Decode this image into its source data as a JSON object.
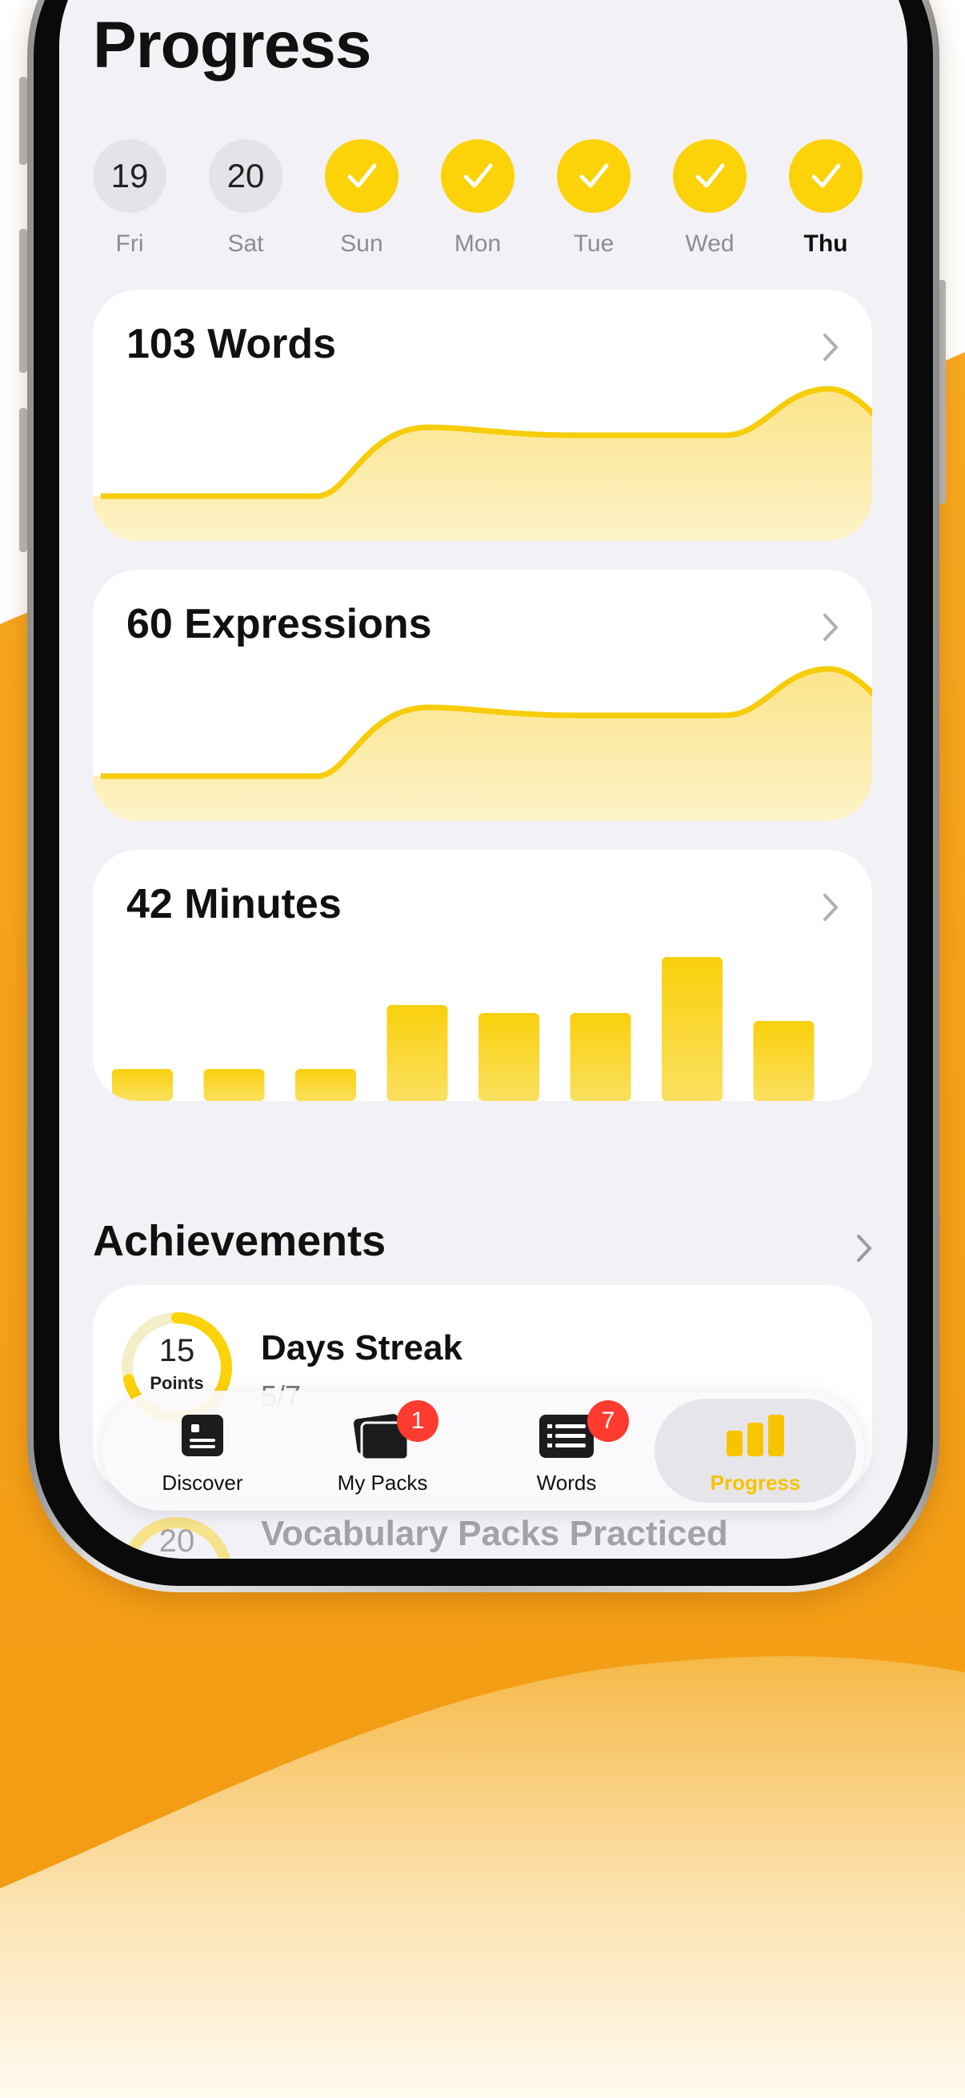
{
  "page": {
    "title": "Progress"
  },
  "week": [
    {
      "day": "Fri",
      "value": "19",
      "done": false,
      "today": false
    },
    {
      "day": "Sat",
      "value": "20",
      "done": false,
      "today": false
    },
    {
      "day": "Sun",
      "value": "",
      "done": true,
      "today": false
    },
    {
      "day": "Mon",
      "value": "",
      "done": true,
      "today": false
    },
    {
      "day": "Tue",
      "value": "",
      "done": true,
      "today": false
    },
    {
      "day": "Wed",
      "value": "",
      "done": true,
      "today": false
    },
    {
      "day": "Thu",
      "value": "",
      "done": true,
      "today": true
    }
  ],
  "cards": {
    "words": {
      "title": "103 Words"
    },
    "expressions": {
      "title": "60 Expressions"
    },
    "minutes": {
      "title": "42 Minutes"
    }
  },
  "minutes_bars": [
    0.15,
    0.15,
    0.15,
    0.55,
    0.5,
    0.5,
    0.85,
    0.45
  ],
  "achievements": {
    "title": "Achievements",
    "items": [
      {
        "points": "15",
        "points_label": "Points",
        "name": "Days Streak",
        "progress": "5/7",
        "fraction": 0.71
      },
      {
        "points": "20",
        "name": "Vocabulary Packs Practiced"
      }
    ]
  },
  "tabbar": {
    "tabs": [
      {
        "label": "Discover",
        "icon": "discover-icon",
        "badge": ""
      },
      {
        "label": "My Packs",
        "icon": "packs-icon",
        "badge": "1"
      },
      {
        "label": "Words",
        "icon": "words-icon",
        "badge": "7"
      },
      {
        "label": "Progress",
        "icon": "progress-icon",
        "badge": "",
        "active": true
      }
    ]
  },
  "colors": {
    "accent": "#fcd208",
    "badge": "#ff3b30",
    "background_orange": "#f5a21c"
  }
}
